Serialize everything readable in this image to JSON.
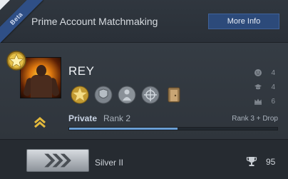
{
  "banner": {
    "beta_label": "Beta",
    "title": "Prime Account Matchmaking",
    "info_button": "More Info"
  },
  "profile": {
    "username": "REY",
    "level_badge_icon": "gold-star-badge-icon",
    "avatar_icon": "player-avatar",
    "medals": [
      {
        "name": "gold-star-medal-icon"
      },
      {
        "name": "shield-medal-icon"
      },
      {
        "name": "soldier-medal-icon"
      },
      {
        "name": "crosshair-medal-icon"
      },
      {
        "name": "door-medal-icon"
      }
    ],
    "stats": [
      {
        "icon": "smiley-icon",
        "value": "4"
      },
      {
        "icon": "grad-cap-icon",
        "value": "4"
      },
      {
        "icon": "crown-icon",
        "value": "6"
      }
    ],
    "rank_name": "Private",
    "rank_number": "Rank 2",
    "next_reward": "Rank 3 + Drop",
    "xp_progress": 0.52
  },
  "competitive": {
    "skill_group": "Silver II",
    "wins": "95",
    "trophy_icon": "trophy-icon"
  },
  "colors": {
    "accent_blue": "#2c4a7a",
    "xp_bar": "#6aa0d6",
    "gold": "#e6c24a"
  }
}
